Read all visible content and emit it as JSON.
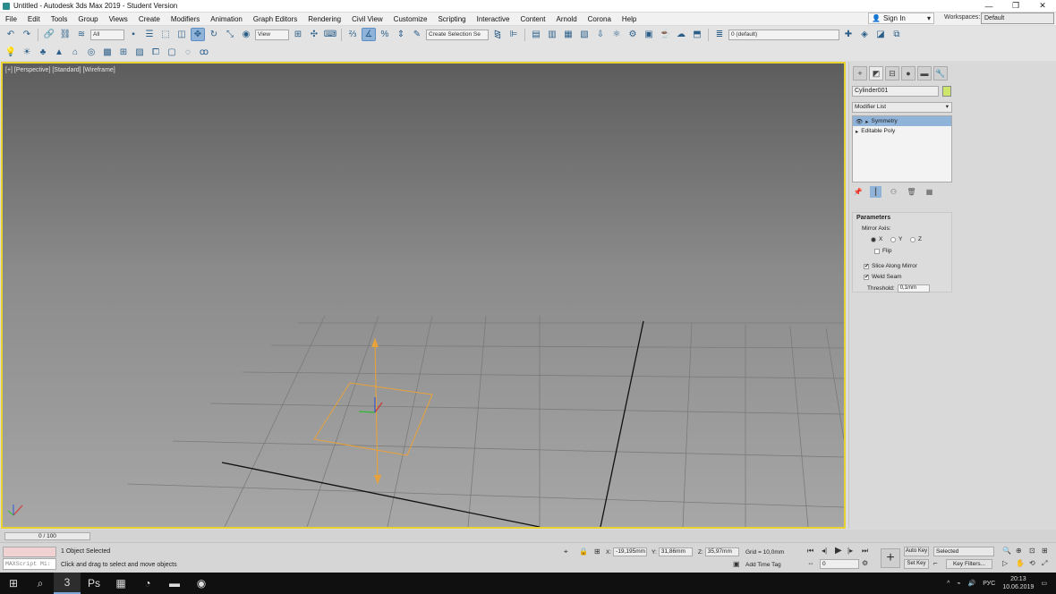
{
  "window": {
    "title": "Untitled - Autodesk 3ds Max 2019 - Student Version",
    "min": "—",
    "max": "❐",
    "close": "✕"
  },
  "menu": [
    "File",
    "Edit",
    "Tools",
    "Group",
    "Views",
    "Create",
    "Modifiers",
    "Animation",
    "Graph Editors",
    "Rendering",
    "Civil View",
    "Customize",
    "Scripting",
    "Interactive",
    "Content",
    "Arnold",
    "Corona",
    "Help"
  ],
  "account": {
    "sign_in": "Sign In",
    "workspaces_label": "Workspaces:",
    "workspace": "Default"
  },
  "toolbar": {
    "filter": "All",
    "ref_coord": "View",
    "selection_set": "Create Selection Se",
    "layer": "0 (default)"
  },
  "viewport": {
    "label": "[+] [Perspective] [Standard] [Wireframe]"
  },
  "command_panel": {
    "object_name": "Cylinder001",
    "object_color": "#cde66c",
    "modifier_list": "Modifier List",
    "stack": [
      {
        "label": "Symmetry",
        "selected": true
      },
      {
        "label": "Editable Poly",
        "selected": false
      }
    ],
    "rollout_title": "Parameters",
    "mirror_axis_label": "Mirror Axis:",
    "axes": [
      {
        "label": "X",
        "checked": true
      },
      {
        "label": "Y",
        "checked": false
      },
      {
        "label": "Z",
        "checked": false
      }
    ],
    "flip_label": "Flip",
    "slice_label": "Slice Along Mirror",
    "weld_label": "Weld Seam",
    "threshold_label": "Threshold:",
    "threshold_value": "0,1mm"
  },
  "timeline": {
    "frame": "0 / 100"
  },
  "status": {
    "maxscript": "MAXScript Mi:",
    "objects_selected": "1 Object Selected",
    "hint": "Click and drag to select and move objects",
    "x_label": "X:",
    "x": "-19,195mm",
    "y_label": "Y:",
    "y": "31,86mm",
    "z_label": "Z:",
    "z": "35,97mm",
    "grid": "Grid = 10,0mm",
    "add_time_tag": "Add Time Tag",
    "auto_key": "Auto Key",
    "set_key": "Set Key",
    "selected": "Selected",
    "key_filters": "Key Filters...",
    "frame_value": "0"
  },
  "taskbar": {
    "lang": "РУС",
    "time": "20:13",
    "date": "10.06.2019"
  }
}
